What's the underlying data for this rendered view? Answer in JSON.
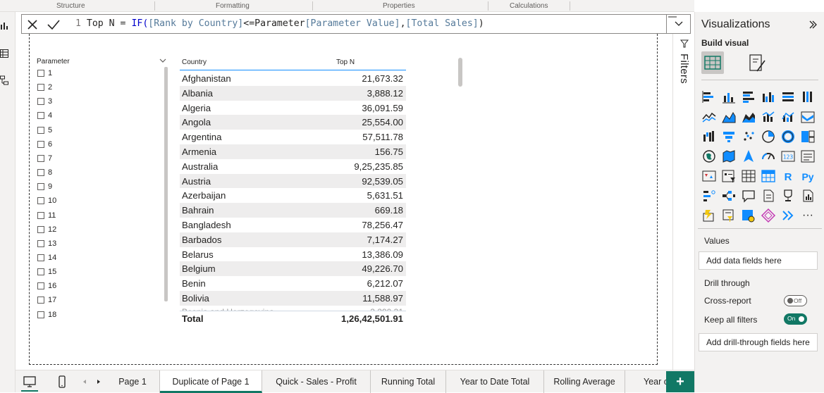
{
  "ribbon": {
    "groups": [
      "Structure",
      "Formatting",
      "Properties",
      "Calculations"
    ]
  },
  "formula": {
    "line_no": "1",
    "prefix": "Top N = ",
    "kw_if": "IF(",
    "f_rank": "[Rank by Country]",
    "op": "<=Parameter",
    "f_param": "[Parameter Value]",
    "comma": ",",
    "f_sales": "[Total Sales]",
    "close": ")"
  },
  "slicer": {
    "title": "Parameter",
    "options": [
      "1",
      "2",
      "3",
      "4",
      "5",
      "6",
      "7",
      "8",
      "9",
      "10",
      "11",
      "12",
      "13",
      "14",
      "15",
      "16",
      "17",
      "18"
    ]
  },
  "table": {
    "col1": "Country",
    "col2": "Top N",
    "rows": [
      {
        "country": "Afghanistan",
        "value": "21,673.32"
      },
      {
        "country": "Albania",
        "value": "3,888.12"
      },
      {
        "country": "Algeria",
        "value": "36,091.59"
      },
      {
        "country": "Angola",
        "value": "25,554.00"
      },
      {
        "country": "Argentina",
        "value": "57,511.78"
      },
      {
        "country": "Armenia",
        "value": "156.75"
      },
      {
        "country": "Australia",
        "value": "9,25,235.85"
      },
      {
        "country": "Austria",
        "value": "92,539.05"
      },
      {
        "country": "Azerbaijan",
        "value": "5,631.51"
      },
      {
        "country": "Bahrain",
        "value": "669.18"
      },
      {
        "country": "Bangladesh",
        "value": "78,256.47"
      },
      {
        "country": "Barbados",
        "value": "7,174.27"
      },
      {
        "country": "Belarus",
        "value": "13,386.09"
      },
      {
        "country": "Belgium",
        "value": "49,226.70"
      },
      {
        "country": "Benin",
        "value": "6,212.07"
      },
      {
        "country": "Bolivia",
        "value": "11,588.97"
      }
    ],
    "total_label": "Total",
    "total_value": "1,26,42,501.91"
  },
  "filters": {
    "label": "Filters"
  },
  "viz": {
    "title": "Visualizations",
    "build_visual": "Build visual",
    "values_label": "Values",
    "values_placeholder": "Add data fields here",
    "drill_through": "Drill through",
    "cross_report": "Cross-report",
    "cross_report_state": "Off",
    "keep_filters": "Keep all filters",
    "keep_filters_state": "On",
    "drill_placeholder": "Add drill-through fields here",
    "r_label": "R",
    "py_label": "Py",
    "num_label": "123",
    "more": "···"
  },
  "tabs": [
    "Page 1",
    "Duplicate of Page 1",
    "Quick - Sales - Profit",
    "Running Total",
    "Year to Date Total",
    "Rolling Average",
    "Year o"
  ],
  "add_tab": "+",
  "colors": {
    "accent": "#117865",
    "selection": "#118dff",
    "icon_blue": "#118dff",
    "icon_dark": "#252423"
  }
}
